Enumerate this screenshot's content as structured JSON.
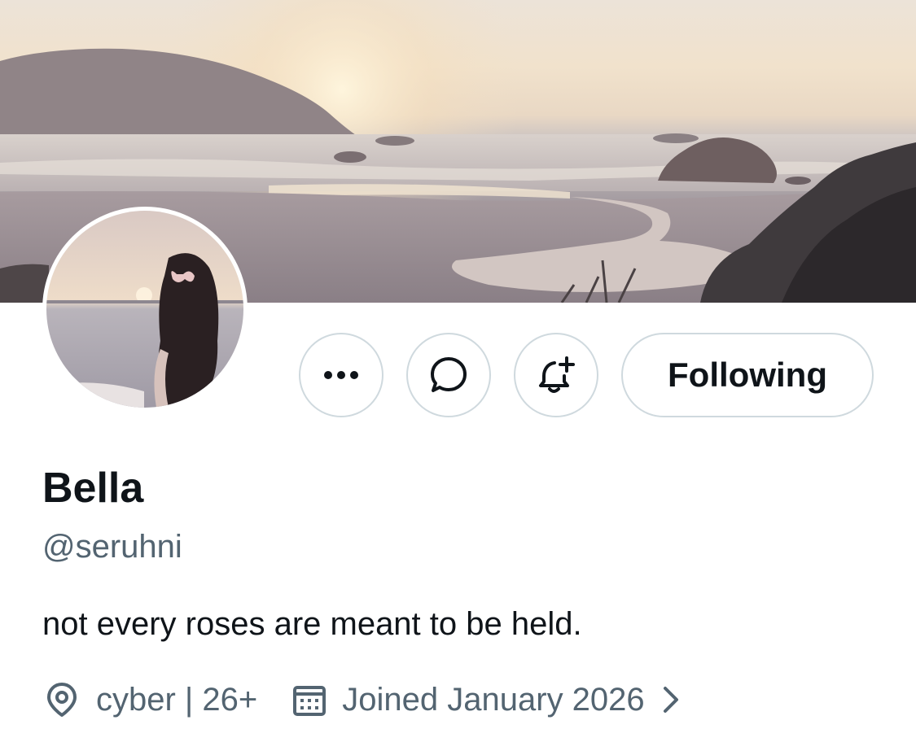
{
  "header": {
    "banner_image": "beach-sunset-banner",
    "avatar_image": "woman-at-beach-avatar"
  },
  "actions": {
    "more_icon": "ellipsis-icon",
    "message_icon": "chat-bubble-icon",
    "notify_icon": "bell-plus-icon",
    "follow_label": "Following"
  },
  "profile": {
    "name": "Bella",
    "handle": "@seruhni",
    "bio": "not every roses are meant to be held.",
    "location": "cyber | 26+",
    "joined": "Joined January 2026"
  },
  "colors": {
    "text_primary": "#0f1419",
    "text_secondary": "#536471",
    "button_border": "#cfd9de"
  }
}
